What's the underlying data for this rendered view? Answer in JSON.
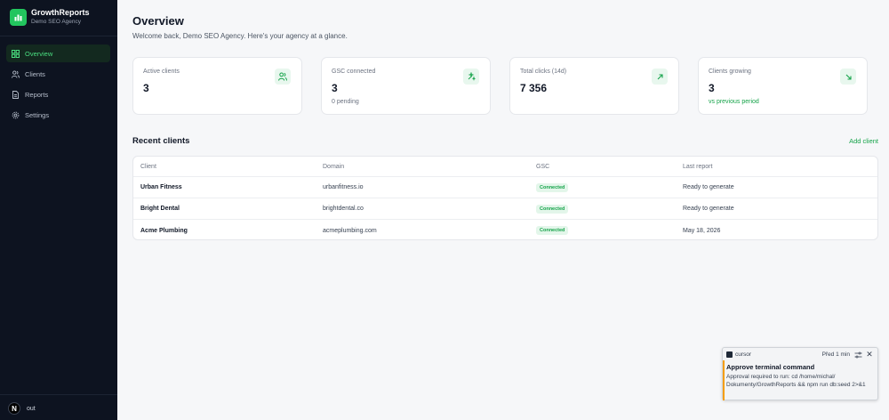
{
  "brand": {
    "title": "GrowthReports",
    "subtitle": "Demo SEO Agency"
  },
  "sidebar": {
    "items": [
      {
        "label": "Overview",
        "icon": "grid-icon",
        "active": true
      },
      {
        "label": "Clients",
        "icon": "users-icon"
      },
      {
        "label": "Reports",
        "icon": "document-icon"
      },
      {
        "label": "Settings",
        "icon": "gear-icon"
      }
    ],
    "bottom": {
      "badge": "N",
      "label": "out"
    }
  },
  "header": {
    "title": "Overview",
    "subtitle": "Welcome back, Demo SEO Agency. Here's your agency at a glance."
  },
  "stats": [
    {
      "label": "Active clients",
      "value": "3",
      "note": "",
      "icon": "users-icon"
    },
    {
      "label": "GSC connected",
      "value": "3",
      "note": "0 pending",
      "icon": "sparkle-icon"
    },
    {
      "label": "Total clicks (14d)",
      "value": "7 356",
      "note": "",
      "icon": "arrow-up-right-icon"
    },
    {
      "label": "Clients growing",
      "value": "3",
      "note": "vs previous period",
      "icon": "arrow-down-right-icon"
    }
  ],
  "recent": {
    "title": "Recent clients",
    "add_label": "Add client",
    "columns": [
      "Client",
      "Domain",
      "GSC",
      "Last report"
    ],
    "rows": [
      {
        "client": "Urban Fitness",
        "domain": "urbanfitness.io",
        "gsc": "Connected",
        "last_report": "Ready to generate"
      },
      {
        "client": "Bright Dental",
        "domain": "brightdental.co",
        "gsc": "Connected",
        "last_report": "Ready to generate"
      },
      {
        "client": "Acme Plumbing",
        "domain": "acmeplumbing.com",
        "gsc": "Connected",
        "last_report": "May 18, 2026"
      }
    ]
  },
  "notification": {
    "app": "cursor",
    "time": "Před 1 min",
    "title": "Approve terminal command",
    "body": "Approval required to run: cd /home/michal/ Dokumenty/GrowthReports && npm run db:seed 2>&1"
  },
  "colors": {
    "accent": "#16a34a",
    "sidebar_bg": "#0d1320",
    "badge_bg": "#e3f6ea",
    "warning": "#f59e0b"
  }
}
